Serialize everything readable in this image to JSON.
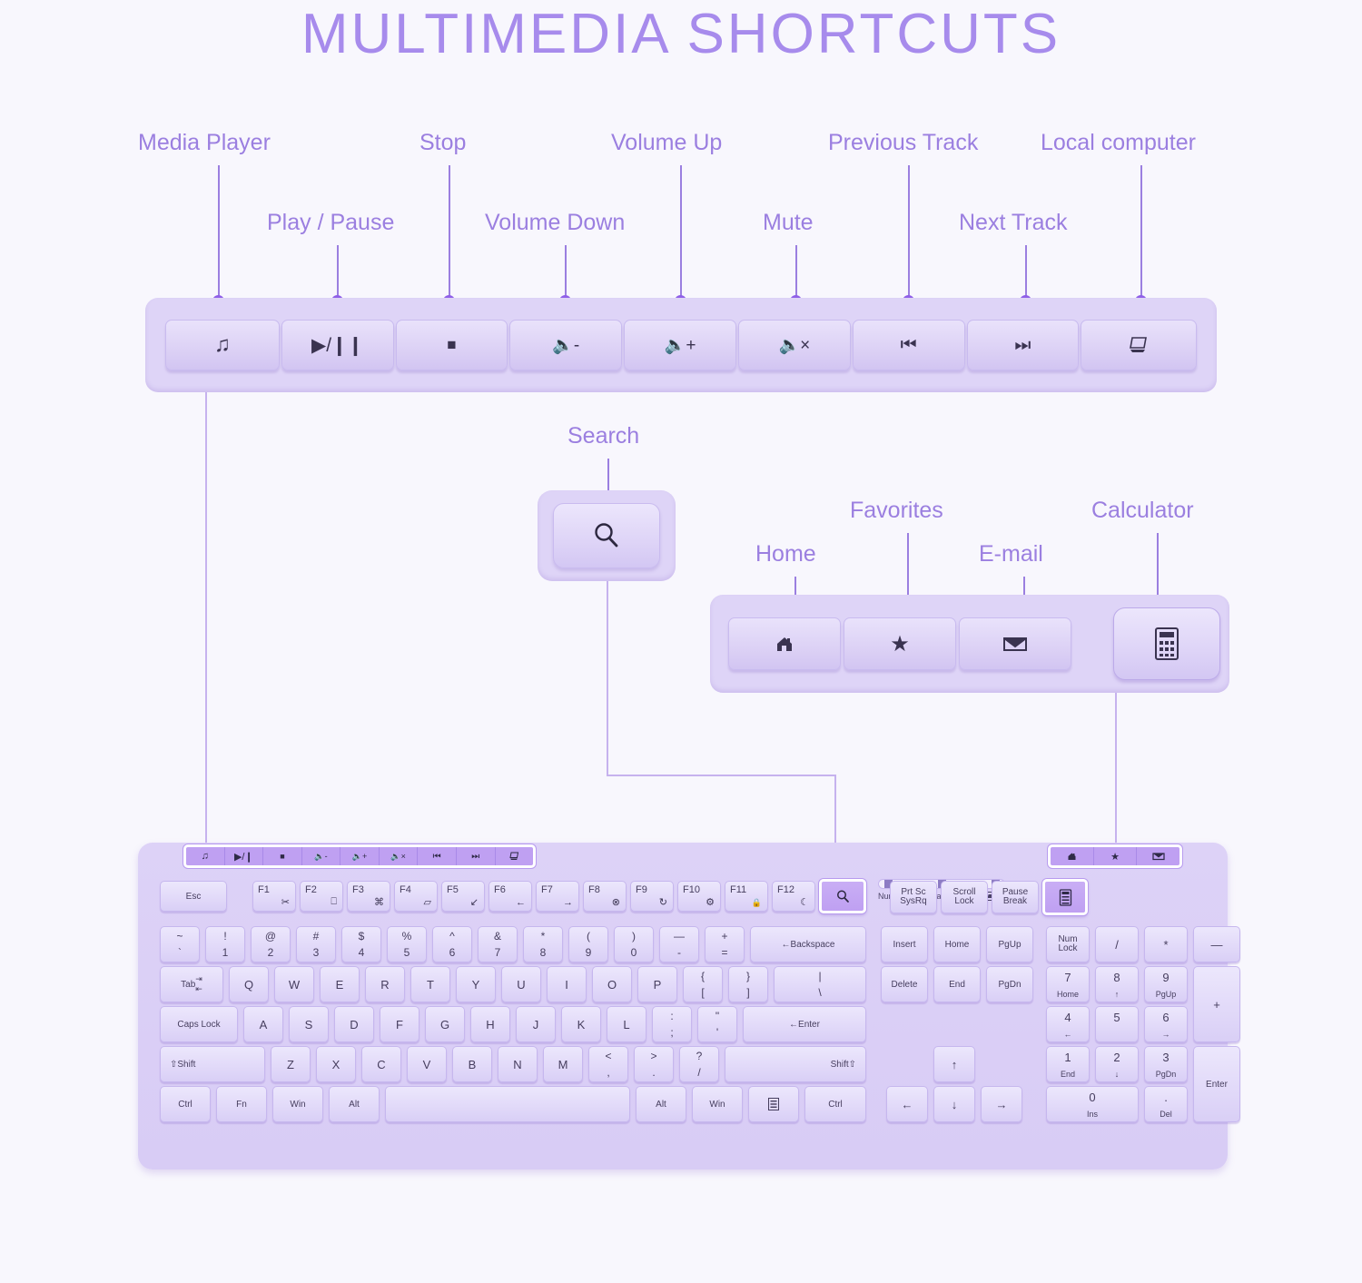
{
  "title": "MULTIMEDIA SHORTCUTS",
  "colors": {
    "accent": "#9b7fe0",
    "title": "#a78bec",
    "background": "#f8f7fd",
    "key_face": "#e2daf9",
    "highlight_key": "#bfa0f2",
    "tray": "#ded4f7"
  },
  "callouts": {
    "media_player": "Media Player",
    "play_pause": "Play / Pause",
    "stop": "Stop",
    "volume_down": "Volume Down",
    "volume_up": "Volume Up",
    "mute": "Mute",
    "previous_track": "Previous Track",
    "next_track": "Next Track",
    "local_computer": "Local computer",
    "search": "Search",
    "home": "Home",
    "favorites": "Favorites",
    "email": "E-mail",
    "calculator": "Calculator"
  },
  "media_bar": {
    "keys": [
      {
        "name": "media-player-key",
        "glyph": "♫"
      },
      {
        "name": "play-pause-key",
        "glyph": "▶/❙❙"
      },
      {
        "name": "stop-key",
        "glyph": "■"
      },
      {
        "name": "volume-down-key",
        "glyph": "🔈-"
      },
      {
        "name": "volume-up-key",
        "glyph": "🔈+"
      },
      {
        "name": "mute-key",
        "glyph": "🔈×"
      },
      {
        "name": "previous-track-key",
        "glyph": "⏮"
      },
      {
        "name": "next-track-key",
        "glyph": "⏭"
      },
      {
        "name": "local-computer-key",
        "glyph": "Ὓ3"
      }
    ]
  },
  "search_key": {
    "glyph": "⌕"
  },
  "right_bar": {
    "keys": [
      {
        "name": "home-key",
        "glyph": "⌂"
      },
      {
        "name": "favorites-key",
        "glyph": "★"
      },
      {
        "name": "email-key",
        "glyph": "✉"
      }
    ],
    "calculator": {
      "name": "calculator-key",
      "glyph": "὚9"
    }
  },
  "keyboard": {
    "media_strip": [
      "♫",
      "▶/❙",
      "■",
      "🔈-",
      "🔈+",
      "🔈×",
      "⏮",
      "⏭",
      "Ὓ3"
    ],
    "right_strip": [
      "⌂",
      "★",
      "✉"
    ],
    "esc": "Esc",
    "function_keys": [
      {
        "label": "F1",
        "icon": "✂"
      },
      {
        "label": "F2",
        "icon": "⎕"
      },
      {
        "label": "F3",
        "icon": "⌘"
      },
      {
        "label": "F4",
        "icon": "▱"
      },
      {
        "label": "F5",
        "icon": "↙"
      },
      {
        "label": "F6",
        "icon": "←"
      },
      {
        "label": "F7",
        "icon": "→"
      },
      {
        "label": "F8",
        "icon": "⊗"
      },
      {
        "label": "F9",
        "icon": "↻"
      },
      {
        "label": "F10",
        "icon": "⚙"
      },
      {
        "label": "F11",
        "icon": "🔒"
      },
      {
        "label": "F12",
        "icon": "☾"
      }
    ],
    "search_fn_key": "⌕",
    "indicators": {
      "num_lock": "Num Lock",
      "caps_lock": "Caps Lock",
      "battery": "battery-icon"
    },
    "system_keys": [
      {
        "line1": "Prt Sc",
        "line2": "SysRq"
      },
      {
        "line1": "Scroll",
        "line2": "Lock"
      },
      {
        "line1": "Pause",
        "line2": "Break"
      }
    ],
    "calculator_fn_key": "὚9",
    "number_row": [
      {
        "top": "~",
        "bot": "`"
      },
      {
        "top": "!",
        "bot": "1"
      },
      {
        "top": "@",
        "bot": "2"
      },
      {
        "top": "#",
        "bot": "3"
      },
      {
        "top": "$",
        "bot": "4"
      },
      {
        "top": "%",
        "bot": "5"
      },
      {
        "top": "^",
        "bot": "6"
      },
      {
        "top": "&",
        "bot": "7"
      },
      {
        "top": "*",
        "bot": "8"
      },
      {
        "top": "(",
        "bot": "9"
      },
      {
        "top": ")",
        "bot": "0"
      },
      {
        "top": "—",
        "bot": "-"
      },
      {
        "top": "+",
        "bot": "="
      }
    ],
    "backspace": "←Backspace",
    "tab": "Tab",
    "qwerty_row": [
      "Q",
      "W",
      "E",
      "R",
      "T",
      "Y",
      "U",
      "I",
      "O",
      "P"
    ],
    "bracket_keys": [
      {
        "top": "{",
        "bot": "["
      },
      {
        "top": "}",
        "bot": "]"
      },
      {
        "top": "|",
        "bot": "\\"
      }
    ],
    "caps_lock": "Caps Lock",
    "asdf_row": [
      "A",
      "S",
      "D",
      "F",
      "G",
      "H",
      "J",
      "K",
      "L"
    ],
    "punct_keys": [
      {
        "top": ":",
        "bot": ";"
      },
      {
        "top": "\"",
        "bot": "'"
      }
    ],
    "enter": "←Enter",
    "shift_left": "⇧Shift",
    "zxcv_row": [
      "Z",
      "X",
      "C",
      "V",
      "B",
      "N",
      "M"
    ],
    "comma_keys": [
      {
        "top": "<",
        "bot": ","
      },
      {
        "top": ">",
        "bot": "."
      },
      {
        "top": "?",
        "bot": "/"
      }
    ],
    "shift_right": "Shift⇧",
    "bottom_row": [
      "Ctrl",
      "Fn",
      "Win",
      "Alt"
    ],
    "bottom_row_right": [
      "Alt",
      "Win"
    ],
    "menu_key": "☰",
    "ctrl_right": "Ctrl",
    "nav_cluster": [
      "Insert",
      "Home",
      "PgUp",
      "Delete",
      "End",
      "PgDn"
    ],
    "arrows": {
      "up": "↑",
      "left": "←",
      "down": "↓",
      "right": "→"
    },
    "numpad": {
      "num_lock": {
        "line1": "Num",
        "line2": "Lock"
      },
      "divide": "/",
      "multiply": "*",
      "minus": "—",
      "plus": "+",
      "enter": "Enter",
      "keys": [
        {
          "num": "7",
          "sub": "Home"
        },
        {
          "num": "8",
          "sub": "↑"
        },
        {
          "num": "9",
          "sub": "PgUp"
        },
        {
          "num": "4",
          "sub": "←"
        },
        {
          "num": "5",
          "sub": ""
        },
        {
          "num": "6",
          "sub": "→"
        },
        {
          "num": "1",
          "sub": "End"
        },
        {
          "num": "2",
          "sub": "↓"
        },
        {
          "num": "3",
          "sub": "PgDn"
        },
        {
          "num": "0",
          "sub": "Ins"
        },
        {
          "num": ".",
          "sub": "Del"
        }
      ]
    }
  }
}
